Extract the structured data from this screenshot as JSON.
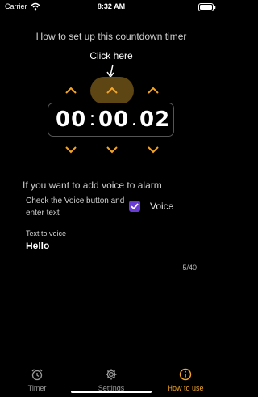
{
  "status_bar": {
    "carrier": "Carrier",
    "time": "8:32 AM",
    "icons": [
      "wifi-icon",
      "battery-icon"
    ]
  },
  "guide": {
    "title": "How to set up this countdown timer",
    "hint": "Click here",
    "hint_icon": "arrow-down-icon"
  },
  "timer": {
    "hours": "00",
    "minutes": "00",
    "seconds": "02",
    "up_icon": "chevron-up-icon",
    "down_icon": "chevron-down-icon"
  },
  "voice": {
    "header": "If you want to add voice to alarm",
    "instruction": "Check the Voice button and enter text",
    "checkbox_label": "Voice",
    "checked": true,
    "tts_label": "Text to voice",
    "tts_value": "Hello",
    "char_count": "5/40"
  },
  "tabs": [
    {
      "label": "Timer",
      "icon": "alarm-clock-icon",
      "active": false
    },
    {
      "label": "Settings",
      "icon": "gear-icon",
      "active": false
    },
    {
      "label": "How to use",
      "icon": "info-icon",
      "active": true
    }
  ],
  "colors": {
    "accent": "#F5A623",
    "background": "#000000",
    "checkbox": "#6A3CD6",
    "highlight": "#5E4614",
    "inactive_tab": "#9A9A9A"
  }
}
